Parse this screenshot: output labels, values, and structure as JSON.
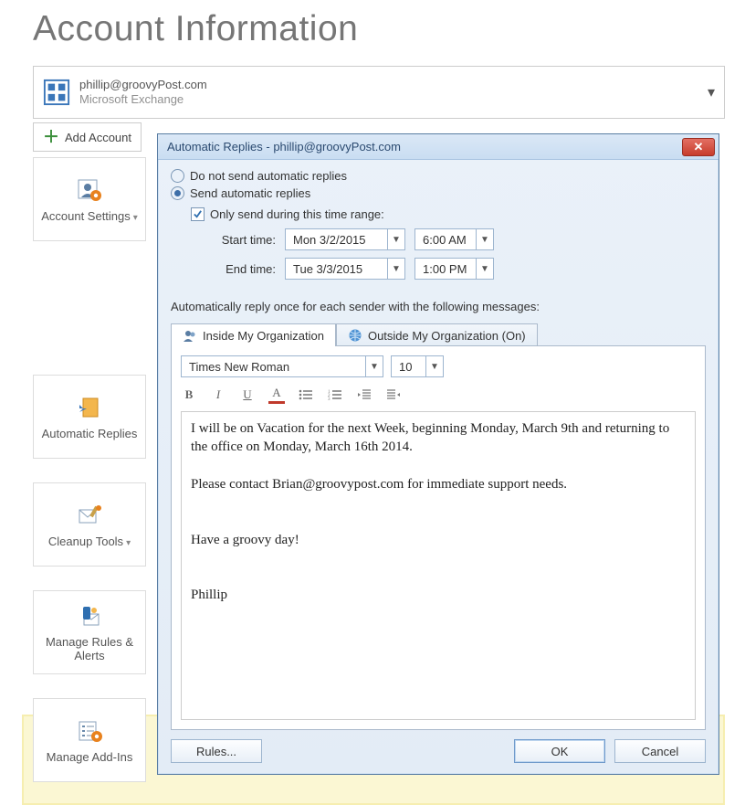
{
  "header": {
    "title": "Account Information"
  },
  "account": {
    "email": "phillip@groovyPost.com",
    "type": "Microsoft Exchange",
    "addLabel": "Add Account"
  },
  "sidebar": {
    "accountSettings": "Account Settings",
    "autoReplies": "Automatic Replies",
    "cleanupTools": "Cleanup Tools",
    "manageRules": "Manage Rules & Alerts",
    "manageAddins": "Manage Add-Ins"
  },
  "dialog": {
    "title": "Automatic Replies -  phillip@groovyPost.com",
    "option_noSend": "Do not send automatic replies",
    "option_send": "Send automatic replies",
    "onlyRangeLabel": "Only send during this time range:",
    "startLabel": "Start time:",
    "endLabel": "End time:",
    "startDate": "Mon 3/2/2015",
    "startTime": "6:00 AM",
    "endDate": "Tue 3/3/2015",
    "endTime": "1:00 PM",
    "replyOnceLabel": "Automatically reply once for each sender with the following messages:",
    "tabs": {
      "inside": "Inside My Organization",
      "outside": "Outside My Organization (On)"
    },
    "font": {
      "name": "Times New Roman",
      "size": "10"
    },
    "message": "I will be on Vacation for the next Week, beginning Monday, March 9th and returning to the office on Monday, March 16th 2014.\n\nPlease contact Brian@groovypost.com for immediate support needs.\n\n\nHave a groovy day!\n\n\nPhillip",
    "buttons": {
      "rules": "Rules...",
      "ok": "OK",
      "cancel": "Cancel"
    }
  }
}
